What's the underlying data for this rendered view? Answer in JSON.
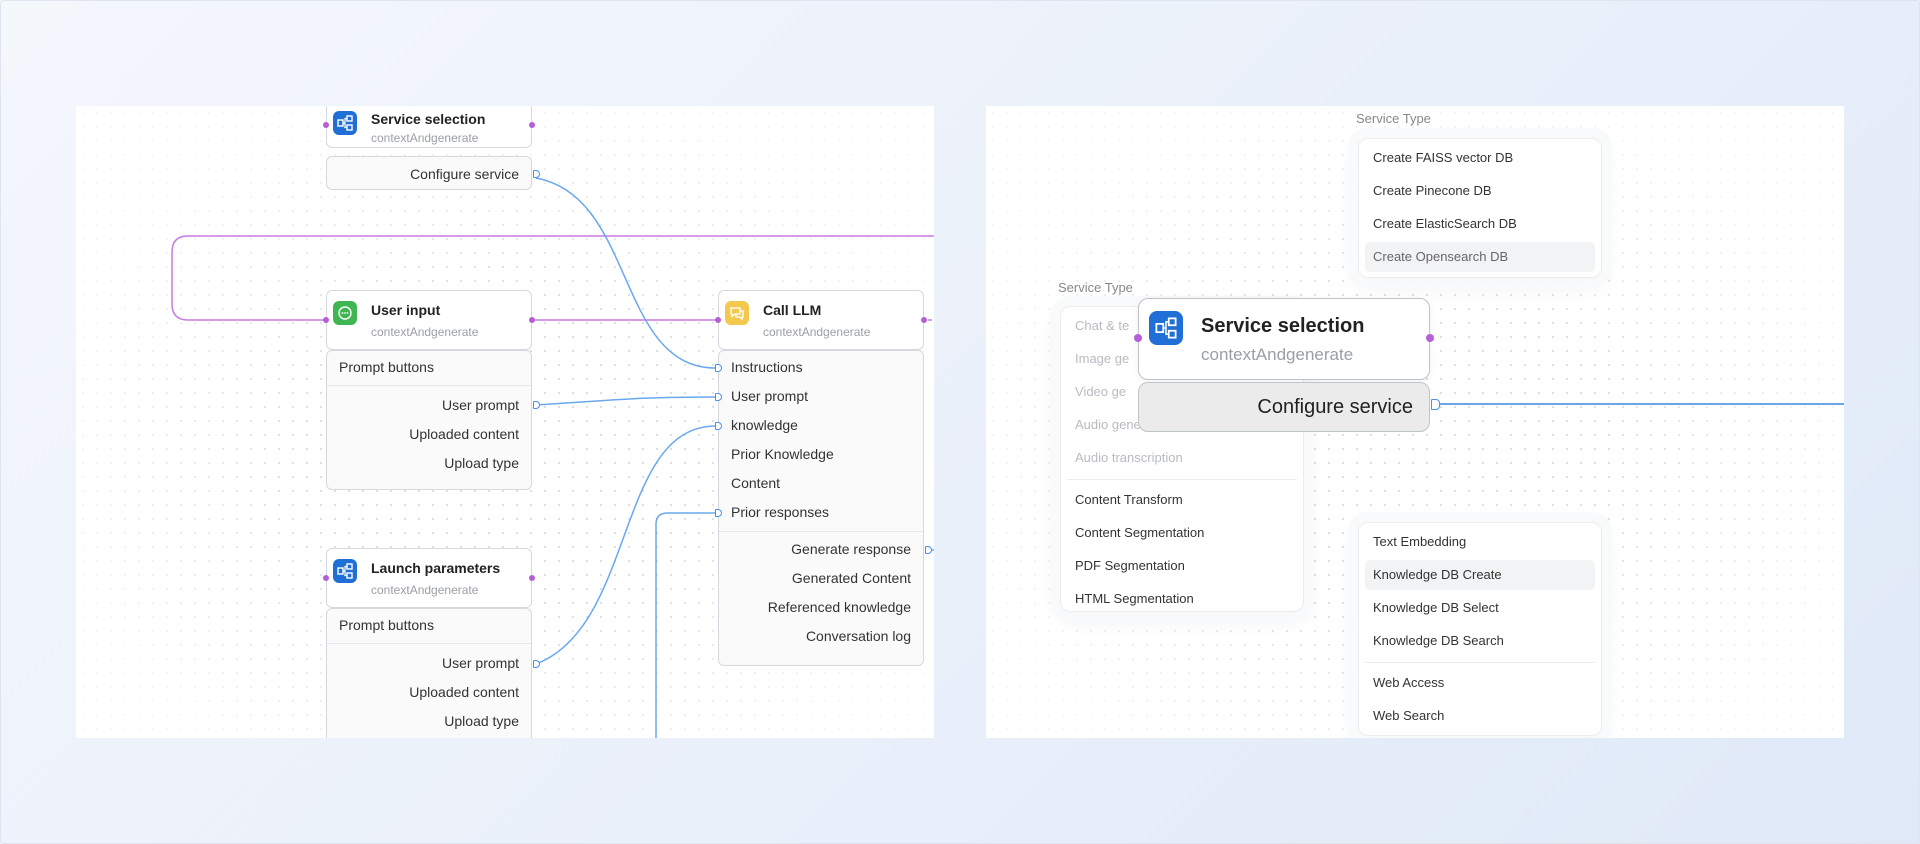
{
  "left": {
    "service_node": {
      "title": "Service selection",
      "subtitle": "contextAndgenerate",
      "rows": [
        "Configure service"
      ]
    },
    "user_input_node": {
      "title": "User input",
      "subtitle": "contextAndgenerate",
      "section": "Prompt buttons",
      "rows": [
        "User prompt",
        "Uploaded content",
        "Upload type"
      ]
    },
    "launch_node": {
      "title": "Launch parameters",
      "subtitle": "contextAndgenerate",
      "section": "Prompt buttons",
      "rows": [
        "User prompt",
        "Uploaded content",
        "Upload type"
      ]
    },
    "llm_node": {
      "title": "Call LLM",
      "subtitle": "contextAndgenerate",
      "inputs": [
        "Instructions",
        "User prompt",
        "knowledge",
        "Prior Knowledge",
        "Content",
        "Prior responses"
      ],
      "outputs": [
        "Generate response",
        "Generated Content",
        "Referenced knowledge",
        "Conversation log"
      ]
    }
  },
  "right": {
    "top_menu": {
      "title": "Service Type",
      "items": [
        "Create FAISS vector DB",
        "Create Pinecone DB",
        "Create ElasticSearch DB",
        "Create Opensearch DB"
      ]
    },
    "left_menu": {
      "title": "Service Type",
      "items_top": [
        "Chat & te",
        "Image ge",
        "Video ge",
        "Audio gene",
        "Audio transcription"
      ],
      "items_bottom": [
        "Content Transform",
        "Content Segmentation",
        "PDF Segmentation",
        "HTML Segmentation"
      ]
    },
    "bottom_menu": {
      "items_top": [
        "Text Embedding",
        "Knowledge DB Create",
        "Knowledge DB Select",
        "Knowledge DB Search"
      ],
      "items_bottom": [
        "Web Access",
        "Web Search"
      ]
    },
    "service_node": {
      "title": "Service selection",
      "subtitle": "contextAndgenerate",
      "row": "Configure service"
    }
  },
  "colors": {
    "accent_blue": "#1f6fd6",
    "wire_blue": "#6aa8ee",
    "wire_purple": "#c77ae0",
    "icon_green": "#3fb553",
    "icon_yellow": "#f2c94c"
  }
}
